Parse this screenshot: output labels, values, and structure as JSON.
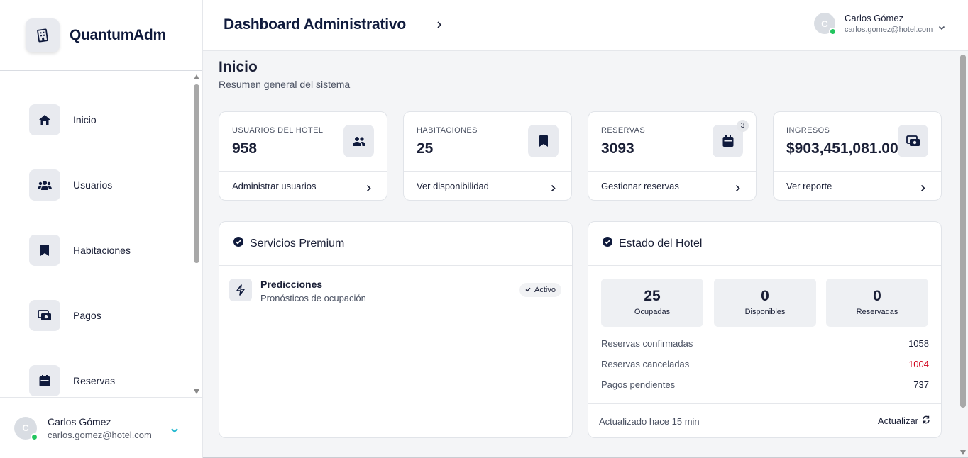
{
  "brand": {
    "name": "QuantumAdm",
    "icon": "building-icon"
  },
  "sidebar": {
    "items": [
      {
        "label": "Inicio",
        "icon": "home-icon"
      },
      {
        "label": "Usuarios",
        "icon": "users-icon"
      },
      {
        "label": "Habitaciones",
        "icon": "bookmark-icon"
      },
      {
        "label": "Pagos",
        "icon": "money-icon"
      },
      {
        "label": "Reservas",
        "icon": "calendar-icon"
      }
    ],
    "user": {
      "initial": "C",
      "name": "Carlos Gómez",
      "email": "carlos.gomez@hotel.com",
      "status_color": "#22c55e"
    }
  },
  "header": {
    "title": "Dashboard Administrativo",
    "user": {
      "initial": "C",
      "name": "Carlos Gómez",
      "email": "carlos.gomez@hotel.com"
    }
  },
  "page": {
    "title": "Inicio",
    "subtitle": "Resumen general del sistema"
  },
  "stats": [
    {
      "label": "USUARIOS DEL HOTEL",
      "value": "958",
      "icon": "users-icon",
      "link": "Administrar usuarios"
    },
    {
      "label": "HABITACIONES",
      "value": "25",
      "icon": "bookmark-icon",
      "link": "Ver disponibilidad"
    },
    {
      "label": "RESERVAS",
      "value": "3093",
      "icon": "calendar-icon",
      "badge": "3",
      "link": "Gestionar reservas"
    },
    {
      "label": "INGRESOS",
      "value": "$903,451,081.00",
      "icon": "money-icon",
      "link": "Ver reporte"
    }
  ],
  "premium": {
    "title": "Servicios Premium",
    "services": [
      {
        "name": "Predicciones",
        "description": "Pronósticos de ocupación",
        "status": "Activo",
        "icon": "bolt-icon"
      }
    ]
  },
  "hotel_status": {
    "title": "Estado del Hotel",
    "rooms": [
      {
        "value": "25",
        "label": "Ocupadas"
      },
      {
        "value": "0",
        "label": "Disponibles"
      },
      {
        "value": "0",
        "label": "Reservadas"
      }
    ],
    "rows": [
      {
        "label": "Reservas confirmadas",
        "value": "1058"
      },
      {
        "label": "Reservas canceladas",
        "value": "1004",
        "color": "#d0021b"
      },
      {
        "label": "Pagos pendientes",
        "value": "737"
      }
    ],
    "updated": "Actualizado hace 15 min",
    "refresh_label": "Actualizar"
  }
}
